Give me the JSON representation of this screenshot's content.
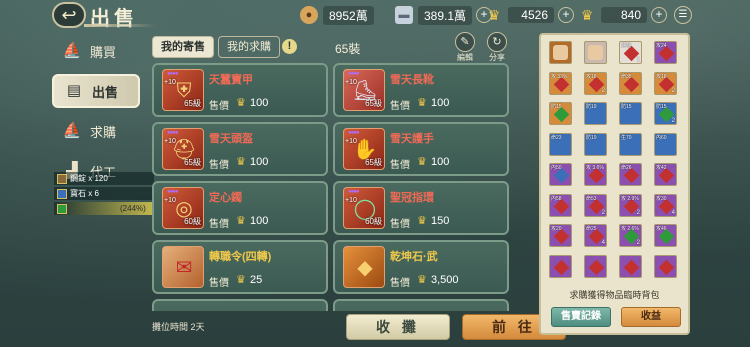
{
  "header": {
    "title": "出售",
    "currencies": [
      {
        "icon": "copper-coin-icon",
        "value": "8952萬"
      },
      {
        "icon": "silver-ingot-icon",
        "value": "389.1萬"
      },
      {
        "icon": "gold-ingot-icon",
        "value": "4526"
      },
      {
        "icon": "yuanbao-icon",
        "value": "840"
      }
    ]
  },
  "sidebar": {
    "items": [
      {
        "label": "購買",
        "icon": "buy-icon",
        "active": false
      },
      {
        "label": "出售",
        "icon": "sell-icon",
        "active": true
      },
      {
        "label": "求購",
        "icon": "request-icon",
        "active": false
      },
      {
        "label": "代工",
        "icon": "craft-icon",
        "active": false
      }
    ],
    "overlay": [
      {
        "text": "鋼錠 x 120"
      },
      {
        "text": "寶石 x 6"
      },
      {
        "text": "(244%)"
      }
    ]
  },
  "tabs": [
    {
      "label": "我的寄售",
      "active": true
    },
    {
      "label": "我的求購",
      "active": false
    }
  ],
  "slot_count": "65裝",
  "tools": [
    {
      "label": "編輯",
      "icon": "edit-icon"
    },
    {
      "label": "分享",
      "icon": "share-icon"
    }
  ],
  "price_label": "售價",
  "items": [
    {
      "name": "天蠶寶甲",
      "level": "65級",
      "plus": "+10",
      "price": "100",
      "color": "red",
      "icon": "armor-icon"
    },
    {
      "name": "雪天長靴",
      "level": "65級",
      "plus": "+10",
      "price": "100",
      "color": "red",
      "icon": "boots-icon"
    },
    {
      "name": "雪天頭盔",
      "level": "65級",
      "plus": "+10",
      "price": "100",
      "color": "red",
      "icon": "helmet-icon"
    },
    {
      "name": "雪天護手",
      "level": "65級",
      "plus": "+10",
      "price": "100",
      "color": "red",
      "icon": "gauntlet-icon"
    },
    {
      "name": "定心鐲",
      "level": "60級",
      "plus": "+10",
      "price": "100",
      "color": "red",
      "icon": "bracelet-icon"
    },
    {
      "name": "聖冠指環",
      "level": "60級",
      "plus": "+10",
      "price": "150",
      "color": "red",
      "icon": "ring-icon"
    },
    {
      "name": "轉職令(四轉)",
      "level": "",
      "plus": "",
      "price": "25",
      "color": "gold",
      "icon": "token-icon"
    },
    {
      "name": "乾坤石·武",
      "level": "",
      "plus": "",
      "price": "3,500",
      "color": "gold",
      "icon": "stone-icon"
    }
  ],
  "footer": {
    "stall_time": "攤位時間 2天",
    "collect_label": "收 攤",
    "go_label": "前 往"
  },
  "bag": {
    "caption": "求購獲得物品臨時背包",
    "record_label": "售賣記錄",
    "earn_label": "收益",
    "slots": [
      {
        "tag": "",
        "count": "",
        "color": "#b36b2a",
        "gem": "portrait"
      },
      {
        "tag": "",
        "count": "",
        "color": "#c9b9b0",
        "gem": "portrait"
      },
      {
        "tag": "速翻",
        "count": "1",
        "color": "#e4e0d8",
        "gem": "#c23030"
      },
      {
        "tag": "攻24",
        "count": "",
        "color": "#8b4fb0",
        "gem": "#c23030"
      },
      {
        "tag": "攻 33%",
        "count": "",
        "color": "#d68b3a",
        "gem": "#c23030"
      },
      {
        "tag": "攻18",
        "count": "2",
        "color": "#d68b3a",
        "gem": "#c23030"
      },
      {
        "tag": "命35",
        "count": "",
        "color": "#d68b3a",
        "gem": "#c23030"
      },
      {
        "tag": "攻18",
        "count": "2",
        "color": "#d68b3a",
        "gem": "#c23030"
      },
      {
        "tag": "防15",
        "count": "",
        "color": "#d68b3a",
        "gem": "#2f9a3a"
      },
      {
        "tag": "防19",
        "count": "",
        "color": "#3b6fb8",
        "gem": "#3b6fb8"
      },
      {
        "tag": "防15",
        "count": "",
        "color": "#3b6fb8",
        "gem": "#3b6fb8"
      },
      {
        "tag": "防15",
        "count": "2",
        "color": "#3b6fb8",
        "gem": "#2f9a3a"
      },
      {
        "tag": "命23",
        "count": "",
        "color": "#3b6fb8",
        "gem": "#3b6fb8"
      },
      {
        "tag": "防19",
        "count": "",
        "color": "#3b6fb8",
        "gem": "#3b6fb8"
      },
      {
        "tag": "生70",
        "count": "",
        "color": "#3b6fb8",
        "gem": "#3b6fb8"
      },
      {
        "tag": "內60",
        "count": "",
        "color": "#3b6fb8",
        "gem": "#3b6fb8"
      },
      {
        "tag": "內50",
        "count": "",
        "color": "#8b4fb0",
        "gem": "#3b6fb8"
      },
      {
        "tag": "攻 3.6%",
        "count": "",
        "color": "#8b4fb0",
        "gem": "#c23030"
      },
      {
        "tag": "命26",
        "count": "",
        "color": "#8b4fb0",
        "gem": "#c23030"
      },
      {
        "tag": "攻42",
        "count": "",
        "color": "#8b4fb0",
        "gem": "#c23030"
      },
      {
        "tag": "內58",
        "count": "",
        "color": "#8b4fb0",
        "gem": "#c23030"
      },
      {
        "tag": "命53",
        "count": "2",
        "color": "#8b4fb0",
        "gem": "#c23030"
      },
      {
        "tag": "攻 2.9%",
        "count": "2",
        "color": "#8b4fb0",
        "gem": "#c23030"
      },
      {
        "tag": "攻30",
        "count": "4",
        "color": "#8b4fb0",
        "gem": "#c23030"
      },
      {
        "tag": "攻20",
        "count": "",
        "color": "#8b4fb0",
        "gem": "#c23030"
      },
      {
        "tag": "命25",
        "count": "4",
        "color": "#8b4fb0",
        "gem": "#c23030"
      },
      {
        "tag": "攻 2.6%",
        "count": "2",
        "color": "#8b4fb0",
        "gem": "#2f9a3a"
      },
      {
        "tag": "攻46",
        "count": "",
        "color": "#8b4fb0",
        "gem": "#2f9a3a"
      },
      {
        "tag": "",
        "count": "",
        "color": "#8b4fb0",
        "gem": "#c23030"
      },
      {
        "tag": "",
        "count": "",
        "color": "#8b4fb0",
        "gem": "#c23030"
      },
      {
        "tag": "",
        "count": "",
        "color": "#8b4fb0",
        "gem": "#c23030"
      },
      {
        "tag": "",
        "count": "",
        "color": "#8b4fb0",
        "gem": "#c23030"
      }
    ]
  }
}
